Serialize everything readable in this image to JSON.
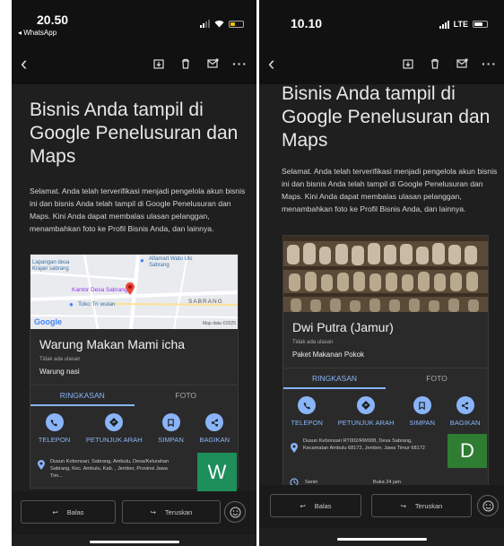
{
  "left": {
    "status": {
      "time": "20.50",
      "back_app": "◂ WhatsApp"
    },
    "email": {
      "headline": "Bisnis Anda tampil di Google Penelusuran dan Maps",
      "body": "Selamat. Anda telah terverifikasi menjadi pengelola akun bisnis ini dan bisnis Anda telah tampil di Google Penelusuran dan Maps. Kini Anda dapat membalas ulasan pelanggan, menambahkan foto ke Profil Bisnis Anda, dan lainnya."
    },
    "map": {
      "places": [
        "Lapangan desa Krajan sabrang",
        "Alfamart Watu Ulo Sabrang",
        "Kantor Desa Sabrang",
        "Toko Tri wulan"
      ],
      "area": "SABRANG",
      "brand": "Google",
      "credit": "Map data ©2025"
    },
    "business": {
      "name": "Warung Makan Mami icha",
      "reviews": "Tidak ada ulasan",
      "category": "Warung nasi",
      "address": "Dusun Kobonsari, Sabrang, Ambulu, Desa/Kelurahan Sabrang, Kec. Ambulu, Kab. , Jember, Provinsi Jawa Tim...",
      "initial": "W",
      "initial_color": "#1e8e5a"
    },
    "tabs": [
      "RINGKASAN",
      "FOTO"
    ],
    "actions": [
      {
        "label": "TELEPON",
        "icon": "phone-icon"
      },
      {
        "label": "PETUNJUK ARAH",
        "icon": "directions-icon"
      },
      {
        "label": "SIMPAN",
        "icon": "bookmark-icon"
      },
      {
        "label": "BAGIKAN",
        "icon": "share-icon"
      }
    ],
    "reply": {
      "reply_label": "Balas",
      "forward_label": "Teruskan"
    }
  },
  "right": {
    "status": {
      "time": "10.10",
      "network": "LTE"
    },
    "email": {
      "headline": "Bisnis Anda tampil di Google Penelusuran dan Maps",
      "body": "Selamat. Anda telah terverifikasi menjadi pengelola akun bisnis ini dan bisnis Anda telah tampil di Google Penelusuran dan Maps. Kini Anda dapat membalas ulasan pelanggan, menambahkan foto ke Profil Bisnis Anda, dan lainnya."
    },
    "business": {
      "name": "Dwi Putra (Jamur)",
      "reviews": "Tidak ada ulasan",
      "category": "Paket Makanan Pokok",
      "address": "Dusun Kebonsari RT002/RW008, Desa Sabrang, Kecamatan Ambulu 68172, Jember, Jawa Timur 68172",
      "initial": "D",
      "initial_color": "#2e7d32",
      "hours_day": "Senin",
      "hours_value": "Buka 24 jam"
    },
    "tabs": [
      "RINGKASAN",
      "FOTO"
    ],
    "actions": [
      {
        "label": "TELEPON",
        "icon": "phone-icon"
      },
      {
        "label": "PETUNJUK ARAH",
        "icon": "directions-icon"
      },
      {
        "label": "SIMPAN",
        "icon": "bookmark-icon"
      },
      {
        "label": "BAGIKAN",
        "icon": "share-icon"
      }
    ],
    "reply": {
      "reply_label": "Balas",
      "forward_label": "Teruskan"
    }
  },
  "colors": {
    "accent": "#8ab4f8",
    "background": "#1f1f1f"
  }
}
